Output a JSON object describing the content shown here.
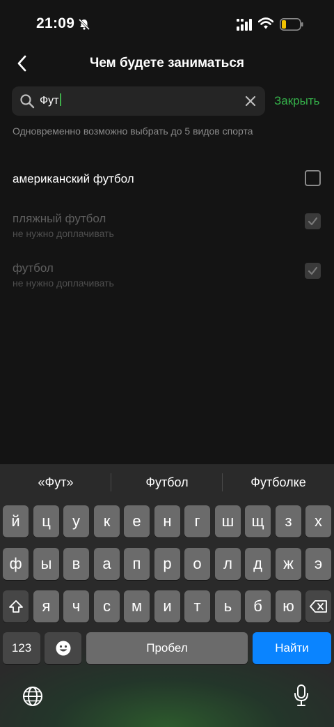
{
  "status_bar": {
    "time": "21:09"
  },
  "header": {
    "title": "Чем будете заниматься"
  },
  "search": {
    "value": "Фут",
    "close_label": "Закрыть"
  },
  "hint": "Одновременно возможно выбрать до 5 видов спорта",
  "items": [
    {
      "title": "американский футбол",
      "subtitle": "",
      "checked": false
    },
    {
      "title": "пляжный футбол",
      "subtitle": "не нужно доплачивать",
      "checked": true
    },
    {
      "title": "футбол",
      "subtitle": "не нужно доплачивать",
      "checked": true
    }
  ],
  "keyboard": {
    "suggestions": [
      "«Фут»",
      "Футбол",
      "Футболке"
    ],
    "row1": [
      "й",
      "ц",
      "у",
      "к",
      "е",
      "н",
      "г",
      "ш",
      "щ",
      "з",
      "х"
    ],
    "row2": [
      "ф",
      "ы",
      "в",
      "а",
      "п",
      "р",
      "о",
      "л",
      "д",
      "ж",
      "э"
    ],
    "row3": [
      "я",
      "ч",
      "с",
      "м",
      "и",
      "т",
      "ь",
      "б",
      "ю"
    ],
    "numbers_label": "123",
    "space_label": "Пробел",
    "return_label": "Найти"
  },
  "colors": {
    "accent_green": "#35b24a",
    "return_blue": "#0a84ff",
    "background": "#141414"
  },
  "icons": [
    "bell-slash-icon",
    "signal-icon",
    "wifi-icon",
    "battery-icon",
    "back-arrow-icon",
    "search-icon",
    "clear-icon",
    "checkbox-icon",
    "shift-icon",
    "backspace-icon",
    "emoji-icon",
    "globe-icon",
    "microphone-icon"
  ]
}
